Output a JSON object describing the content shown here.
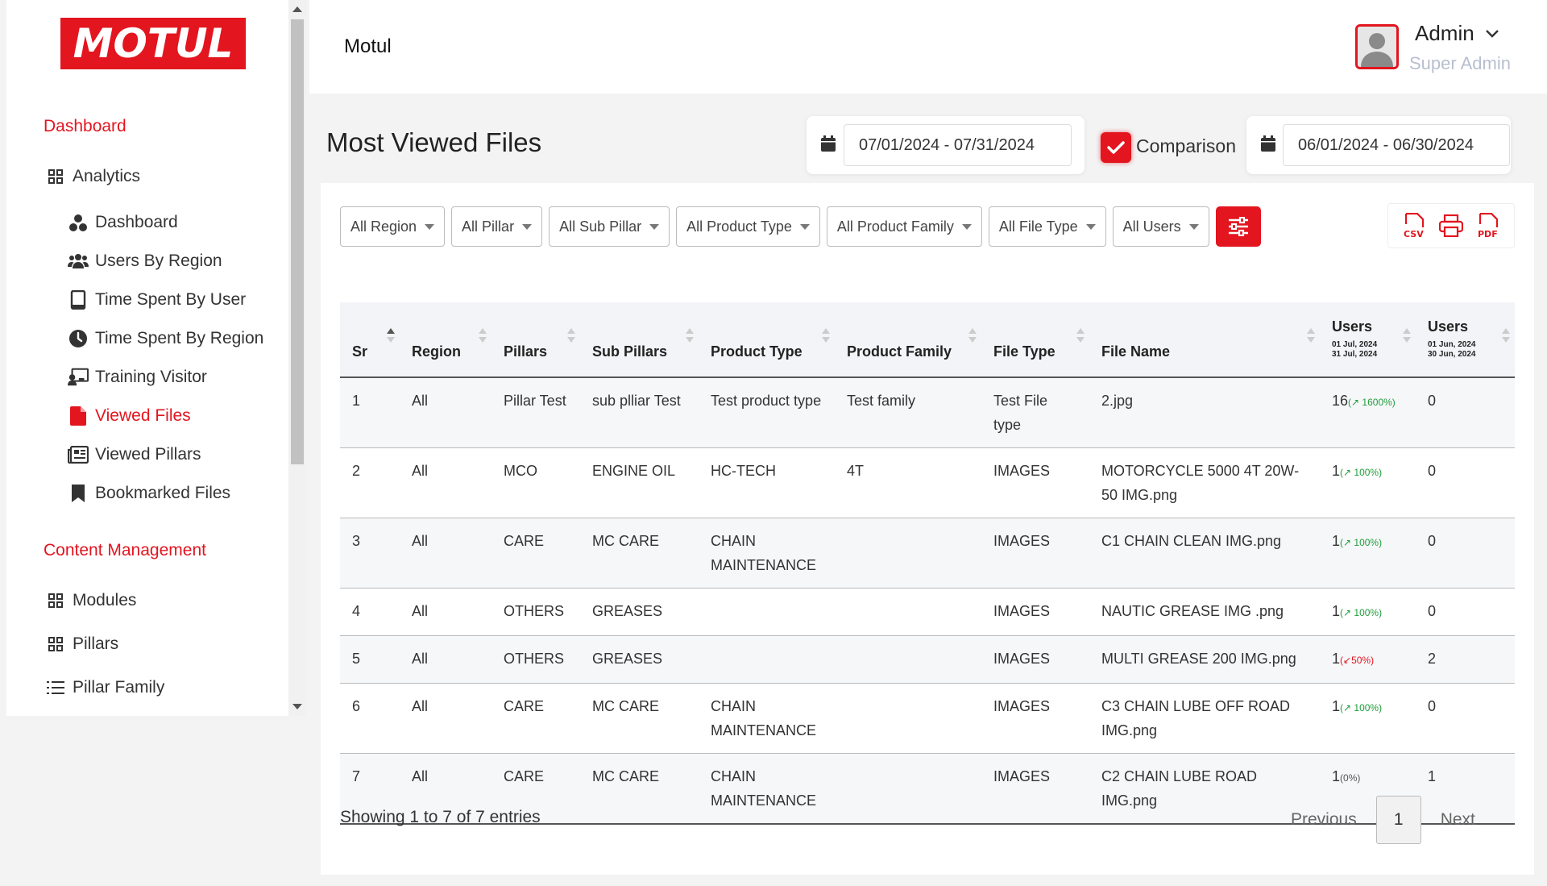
{
  "brand": {
    "logo_text": "MOTUL",
    "app_title": "Motul"
  },
  "user": {
    "name": "Admin",
    "role": "Super Admin"
  },
  "sidebar": {
    "sections": [
      {
        "title": "Dashboard"
      },
      {
        "title": "Content Management"
      }
    ],
    "items": [
      {
        "label": "Analytics",
        "icon": "grid-icon"
      },
      {
        "label": "Dashboard",
        "icon": "users-circle-icon"
      },
      {
        "label": "Users By Region",
        "icon": "users-group-icon"
      },
      {
        "label": "Time Spent By User",
        "icon": "tablet-icon"
      },
      {
        "label": "Time Spent By Region",
        "icon": "clock-icon"
      },
      {
        "label": "Training Visitor",
        "icon": "chalkboard-user-icon"
      },
      {
        "label": "Viewed Files",
        "icon": "file-icon",
        "active": true
      },
      {
        "label": "Viewed Pillars",
        "icon": "newspaper-icon"
      },
      {
        "label": "Bookmarked Files",
        "icon": "bookmark-icon"
      },
      {
        "label": "Modules",
        "icon": "grid-icon"
      },
      {
        "label": "Pillars",
        "icon": "grid-icon"
      },
      {
        "label": "Pillar Family",
        "icon": "list-icon"
      }
    ]
  },
  "page": {
    "title": "Most Viewed Files",
    "date_range": "07/01/2024 - 07/31/2024",
    "comparison_label": "Comparison",
    "comparison_checked": true,
    "comparison_range": "06/01/2024 - 06/30/2024"
  },
  "filters": [
    "All Region",
    "All Pillar",
    "All Sub Pillar",
    "All Product Type",
    "All Product Family",
    "All File Type",
    "All Users"
  ],
  "export": {
    "csv": "CSV",
    "pdf": "PDF"
  },
  "table": {
    "columns": [
      "Sr",
      "Region",
      "Pillars",
      "Sub Pillars",
      "Product Type",
      "Product Family",
      "File Type",
      "File Name",
      "Users",
      "Users"
    ],
    "users_cur_range": [
      "01 Jul, 2024",
      "31 Jul, 2024"
    ],
    "users_cmp_range": [
      "01 Jun, 2024",
      "30 Jun, 2024"
    ],
    "rows": [
      {
        "sr": "1",
        "region": "All",
        "pillar": "Pillar Test",
        "sub_pillar": "sub plliar Test",
        "product_type": "Test product type",
        "product_family": "Test family",
        "file_type": "Test File type",
        "file_name": "2.jpg",
        "users": "16",
        "change": "1600%",
        "dir": "up",
        "users_cmp": "0"
      },
      {
        "sr": "2",
        "region": "All",
        "pillar": "MCO",
        "sub_pillar": "ENGINE OIL",
        "product_type": "HC-TECH",
        "product_family": "4T",
        "file_type": "IMAGES",
        "file_name": "MOTORCYCLE 5000 4T 20W-50 IMG.png",
        "users": "1",
        "change": "100%",
        "dir": "up",
        "users_cmp": "0"
      },
      {
        "sr": "3",
        "region": "All",
        "pillar": "CARE",
        "sub_pillar": "MC CARE",
        "product_type": "CHAIN MAINTENANCE",
        "product_family": "",
        "file_type": "IMAGES",
        "file_name": "C1 CHAIN CLEAN IMG.png",
        "users": "1",
        "change": "100%",
        "dir": "up",
        "users_cmp": "0"
      },
      {
        "sr": "4",
        "region": "All",
        "pillar": "OTHERS",
        "sub_pillar": "GREASES",
        "product_type": "",
        "product_family": "",
        "file_type": "IMAGES",
        "file_name": "NAUTIC GREASE IMG .png",
        "users": "1",
        "change": "100%",
        "dir": "up",
        "users_cmp": "0"
      },
      {
        "sr": "5",
        "region": "All",
        "pillar": "OTHERS",
        "sub_pillar": "GREASES",
        "product_type": "",
        "product_family": "",
        "file_type": "IMAGES",
        "file_name": "MULTI GREASE 200 IMG.png",
        "users": "1",
        "change": "50%",
        "dir": "down",
        "users_cmp": "2"
      },
      {
        "sr": "6",
        "region": "All",
        "pillar": "CARE",
        "sub_pillar": "MC CARE",
        "product_type": "CHAIN MAINTENANCE",
        "product_family": "",
        "file_type": "IMAGES",
        "file_name": "C3 CHAIN LUBE OFF ROAD IMG.png",
        "users": "1",
        "change": "100%",
        "dir": "up",
        "users_cmp": "0"
      },
      {
        "sr": "7",
        "region": "All",
        "pillar": "CARE",
        "sub_pillar": "MC CARE",
        "product_type": "CHAIN MAINTENANCE",
        "product_family": "",
        "file_type": "IMAGES",
        "file_name": "C2 CHAIN LUBE ROAD IMG.png",
        "users": "1",
        "change": "0%",
        "dir": "zero",
        "users_cmp": "1"
      }
    ]
  },
  "footer": {
    "showing": "Showing 1 to 7 of 7 entries",
    "previous": "Previous",
    "current_page": "1",
    "next": "Next"
  },
  "colors": {
    "accent": "#e3151f",
    "up": "#1e9e3a",
    "down": "#e3151f"
  }
}
